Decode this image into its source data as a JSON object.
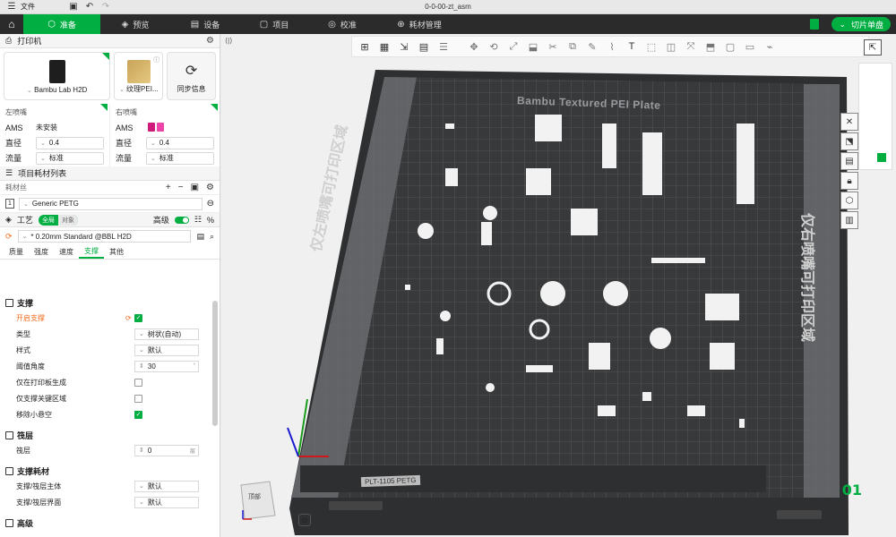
{
  "window": {
    "title": "0-0-00-zt_asm",
    "menu_label": "文件"
  },
  "tabs": [
    {
      "label": "准备",
      "icon": "cube-icon"
    },
    {
      "label": "预览",
      "icon": "layers-icon"
    },
    {
      "label": "设备",
      "icon": "device-icon"
    },
    {
      "label": "项目",
      "icon": "project-icon"
    },
    {
      "label": "校准",
      "icon": "calibrate-icon"
    },
    {
      "label": "耗材管理",
      "icon": "filament-icon"
    }
  ],
  "slice_button": "切片单盘",
  "printer": {
    "section_title": "打印机",
    "printer_name": "Bambu Lab H2D",
    "plate_name": "纹理PEI...",
    "sync_label": "同步信息"
  },
  "nozzles": {
    "left": {
      "title": "左喷嘴",
      "ams_label": "AMS",
      "ams_value": "未安装",
      "diameter_label": "直径",
      "diameter": "0.4",
      "flow_label": "流量",
      "flow": "标准"
    },
    "right": {
      "title": "右喷嘴",
      "ams_label": "AMS",
      "diameter_label": "直径",
      "diameter": "0.4",
      "flow_label": "流量",
      "flow": "标准"
    }
  },
  "filament": {
    "section_title": "项目耗材列表",
    "list_label": "耗材丝",
    "items": [
      {
        "index": "1",
        "name": "Generic PETG"
      }
    ]
  },
  "process": {
    "section_title": "工艺",
    "mode_on": "全局",
    "mode_off": "对象",
    "advanced_label": "高级",
    "preset": "* 0.20mm Standard @BBL H2D",
    "subtabs": [
      "质量",
      "强度",
      "速度",
      "支撑",
      "其他"
    ],
    "active_subtab": "支撑"
  },
  "support": {
    "group_title": "支撑",
    "enable_label": "开启支撑",
    "type_label": "类型",
    "type_value": "树状(自动)",
    "style_label": "样式",
    "style_value": "默认",
    "threshold_label": "阈值角度",
    "threshold_value": "30",
    "threshold_unit": "°",
    "build_plate_only_label": "仅在打印板生成",
    "critical_only_label": "仅支撑关键区域",
    "remove_small_label": "移除小悬空"
  },
  "raft": {
    "group_title": "筏层",
    "layers_label": "筏层",
    "layers_value": "0",
    "layers_unit": "层"
  },
  "support_filament": {
    "group_title": "支撑耗材",
    "base_label": "支撑/筏层主体",
    "base_value": "默认",
    "interface_label": "支撑/筏层界面",
    "interface_value": "默认"
  },
  "advanced_group": "高级",
  "viewport": {
    "plate_label": "Bambu Textured PEI Plate",
    "left_zone_text": "仅左喷嘴可打印区域",
    "right_zone_text": "仅右喷嘴可打印区域",
    "plate_badge": "PLT-1105 PETG",
    "plate_number": "01",
    "view_cube_label": "顶部"
  },
  "colors": {
    "accent": "#00ae42",
    "warning": "#f26b1d",
    "plate_dark": "#2e2f31"
  }
}
